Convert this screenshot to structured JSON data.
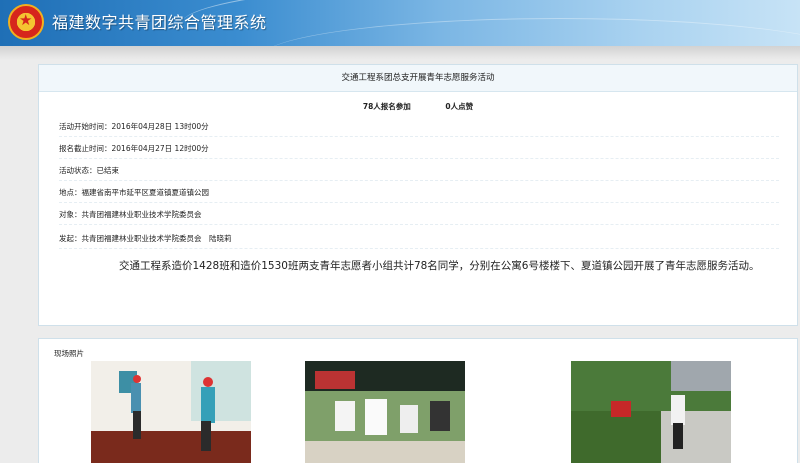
{
  "app": {
    "title": "福建数字共青团综合管理系统"
  },
  "activity": {
    "title": "交通工程系团总支开展青年志愿服务活动",
    "signups": "78人报名参加",
    "likes": "0人点赞",
    "start_time": {
      "label": "活动开始时间：",
      "value": "2016年04月28日 13时00分"
    },
    "deadline": {
      "label": "报名截止时间：",
      "value": "2016年04月27日 12时00分"
    },
    "status": {
      "label": "活动状态：",
      "value": "已结束"
    },
    "location": {
      "label": "地点：",
      "value": "福建省南平市延平区夏道镇夏道镇公园"
    },
    "audience": {
      "label": "对象：",
      "value": "共青团福建林业职业技术学院委员会"
    },
    "organizer": {
      "label": "发起：",
      "value": "共青团福建林业职业技术学院委员会　陆晓莉"
    },
    "description": "交通工程系造价1428班和造价1530班两支青年志愿者小组共计78名同学，分别在公寓6号楼楼下、夏道镇公园开展了青年志愿服务活动。"
  },
  "photos": {
    "label": "现场照片"
  }
}
